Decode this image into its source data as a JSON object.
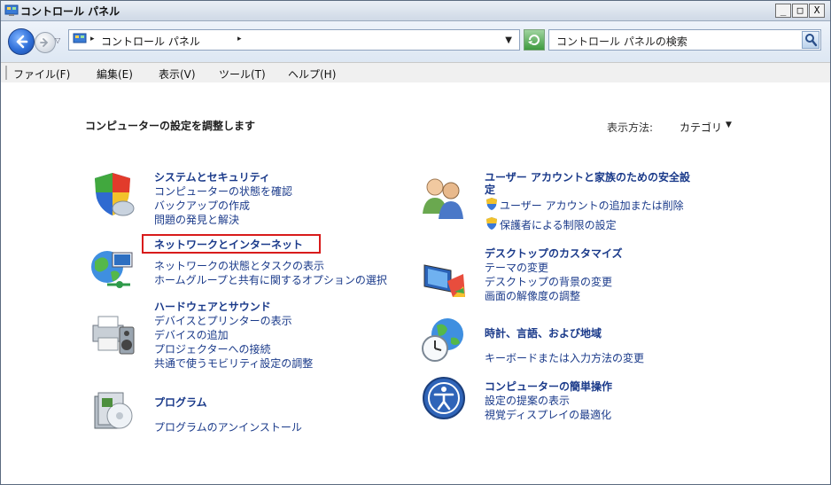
{
  "window": {
    "title": "コントロール パネル",
    "minimize": "_",
    "maximize": "□",
    "close": "X"
  },
  "address_bar": {
    "path": "コントロール パネル",
    "search_placeholder": "コントロール パネルの検索"
  },
  "menu": [
    "ファイル(F)",
    "編集(E)",
    "表示(V)",
    "ツール(T)",
    "ヘルプ(H)"
  ],
  "main": {
    "heading": "コンピューターの設定を調整します",
    "view_by_label": "表示方法:",
    "view_by_value": "カテゴリ"
  },
  "categories": [
    {
      "title": "システムとセキュリティ",
      "icon": "shield-icon",
      "links": [
        "コンピューターの状態を確認",
        "バックアップの作成",
        "問題の発見と解決"
      ]
    },
    {
      "title": "ネットワークとインターネット",
      "icon": "network-globe-icon",
      "highlighted": true,
      "links": [
        "ネットワークの状態とタスクの表示",
        "ホームグループと共有に関するオプションの選択"
      ]
    },
    {
      "title": "ハードウェアとサウンド",
      "icon": "printer-speaker-icon",
      "links": [
        "デバイスとプリンターの表示",
        "デバイスの追加",
        "プロジェクターへの接続",
        "共通で使うモビリティ設定の調整"
      ]
    },
    {
      "title": "プログラム",
      "icon": "program-box-icon",
      "links": [
        "プログラムのアンインストール"
      ]
    },
    {
      "title": "ユーザー アカウントと家族のための安全設",
      "title_line2": "定",
      "icon": "users-icon",
      "links": [
        "ユーザー アカウントの追加または削除",
        "保護者による制限の設定"
      ]
    },
    {
      "title": "デスクトップのカスタマイズ",
      "icon": "desktop-monitor-icon",
      "links": [
        "テーマの変更",
        "デスクトップの背景の変更",
        "画面の解像度の調整"
      ]
    },
    {
      "title": "時計、言語、および地域",
      "icon": "globe-clock-icon",
      "links": [
        "キーボードまたは入力方法の変更"
      ]
    },
    {
      "title": "コンピューターの簡単操作",
      "icon": "accessibility-icon",
      "links": [
        "設定の提案の表示",
        "視覚ディスプレイの最適化"
      ]
    }
  ],
  "colors": {
    "link": "#1a3a8a",
    "highlight_border": "#d81b1b",
    "titlebar": "#cfd9e6"
  }
}
